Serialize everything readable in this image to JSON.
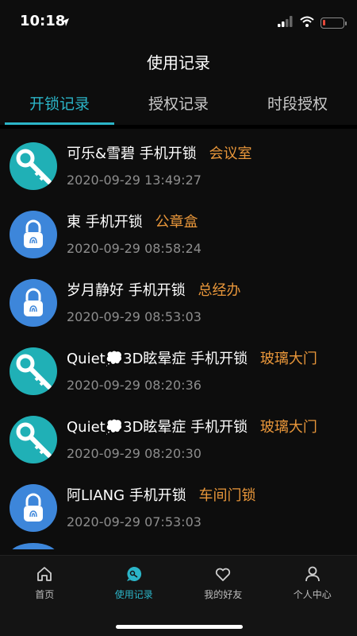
{
  "status": {
    "time": "10:18"
  },
  "title": "使用记录",
  "tabs": [
    {
      "label": "开锁记录",
      "active": true
    },
    {
      "label": "授权记录",
      "active": false
    },
    {
      "label": "时段授权",
      "active": false
    }
  ],
  "records": [
    {
      "icon": "key-icon",
      "user": "可乐&雪碧",
      "method": "手机开锁",
      "place": "会议室",
      "time": "2020-09-29 13:49:27"
    },
    {
      "icon": "fingerprint-lock-icon",
      "user": "東",
      "method": "手机开锁",
      "place": "公章盒",
      "time": "2020-09-29 08:58:24"
    },
    {
      "icon": "fingerprint-lock-icon",
      "user": "岁月静好",
      "method": "手机开锁",
      "place": "总经办",
      "time": "2020-09-29 08:53:03"
    },
    {
      "icon": "key-icon",
      "user": "Quiet💭3D眩晕症",
      "method": "手机开锁",
      "place": "玻璃大门",
      "time": "2020-09-29 08:20:36"
    },
    {
      "icon": "key-icon",
      "user": "Quiet💭3D眩晕症",
      "method": "手机开锁",
      "place": "玻璃大门",
      "time": "2020-09-29 08:20:30"
    },
    {
      "icon": "fingerprint-lock-icon",
      "user": "阿LIANG",
      "method": "手机开锁",
      "place": "车间门锁",
      "time": "2020-09-29 07:53:03"
    }
  ],
  "tabbar": [
    {
      "label": "首页",
      "icon": "home-icon",
      "active": false
    },
    {
      "label": "使用记录",
      "icon": "record-icon",
      "active": true
    },
    {
      "label": "我的好友",
      "icon": "heart-icon",
      "active": false
    },
    {
      "label": "个人中心",
      "icon": "person-icon",
      "active": false
    }
  ],
  "colors": {
    "accent": "#2bb5c8",
    "place": "#e8963a",
    "key_avatar": "#20b0b6",
    "lock_avatar": "#3d86da"
  }
}
